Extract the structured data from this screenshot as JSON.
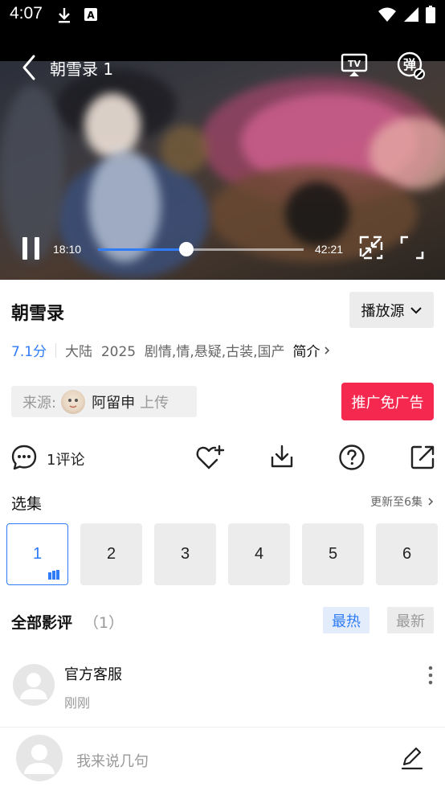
{
  "status_bar": {
    "time": "4:07"
  },
  "player": {
    "title": "朝雪录 1",
    "tv_label": "TV",
    "danmu_label": "弹",
    "current_time": "18:10",
    "total_time": "42:21",
    "progress": 0.429
  },
  "info": {
    "title": "朝雪录",
    "source_button": "播放源",
    "score": "7.1分",
    "meta_text": "大陆  2025  剧情,情,悬疑,古装,国产",
    "intro_label": "简介"
  },
  "uploader": {
    "label": "来源:",
    "name": "阿留申",
    "suffix": "上传",
    "ad_free_button": "推广免广告"
  },
  "actions": {
    "comment_count": "1评论"
  },
  "episodes": {
    "title": "选集",
    "update_text": "更新至6集",
    "items": [
      "1",
      "2",
      "3",
      "4",
      "5",
      "6"
    ],
    "active": "1"
  },
  "reviews": {
    "title": "全部影评",
    "count": "（1）",
    "sort_hot": "最热",
    "sort_new": "最新",
    "items": [
      {
        "user": "官方客服",
        "time": "刚刚"
      }
    ]
  },
  "composer": {
    "placeholder": "我来说几句"
  },
  "colors": {
    "accent": "#2f7cf6",
    "ad_button": "#f5284f"
  }
}
